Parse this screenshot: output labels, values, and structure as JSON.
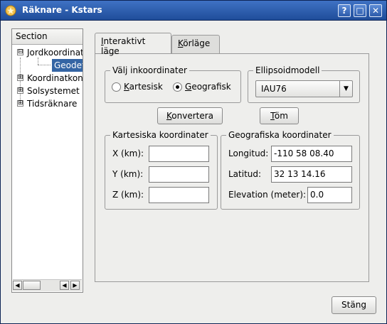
{
  "window": {
    "title": "Räknare - Kstars"
  },
  "titlebar": {
    "help_label": "?",
    "maximize_label": "□",
    "close_label": "✕"
  },
  "sidebar": {
    "header": "Section",
    "items": [
      {
        "label": "Jordkoordinater",
        "expander": "⊟"
      },
      {
        "label": "Geodetisk"
      },
      {
        "label": "Koordinatkonverteringar",
        "expander": "⊞"
      },
      {
        "label": "Solsystemet",
        "expander": "⊞"
      },
      {
        "label": "Tidsräknare",
        "expander": "⊞"
      }
    ]
  },
  "tabs": [
    {
      "label": "Interaktivt läge",
      "mnemonic": "I",
      "rest": "nteraktivt läge"
    },
    {
      "label": "Körläge",
      "mnemonic": "K",
      "rest": "örläge"
    }
  ],
  "input_coords": {
    "title": "Välj inkoordinater",
    "options": [
      {
        "label": "Kartesisk",
        "mnemonic": "K",
        "rest": "artesisk",
        "selected": false
      },
      {
        "label": "Geografisk",
        "mnemonic": "G",
        "rest": "eografisk",
        "selected": true
      }
    ]
  },
  "ellipsoid": {
    "title": "Ellipsoidmodell",
    "selected": "IAU76"
  },
  "actions": {
    "convert": {
      "label": "Konvertera",
      "mnemonic": "K",
      "rest": "onvertera"
    },
    "clear": {
      "label": "Töm",
      "mnemonic": "T",
      "rest": "öm"
    }
  },
  "cartesian": {
    "title": "Kartesiska koordinater",
    "fields": [
      {
        "label": "X (km):",
        "value": ""
      },
      {
        "label": "Y (km):",
        "value": ""
      },
      {
        "label": "Z (km):",
        "value": ""
      }
    ]
  },
  "geographic": {
    "title": "Geografiska koordinater",
    "fields": [
      {
        "label": "Longitud:",
        "value": "-110 58 08.40"
      },
      {
        "label": "Latitud:",
        "value": "32 13 14.16"
      },
      {
        "label": "Elevation (meter):",
        "value": "0.0"
      }
    ]
  },
  "footer": {
    "close_label": "Stäng"
  },
  "colors": {
    "titlebar": "#2c5bab",
    "selection": "#3465a4",
    "window_bg": "#eeeeec"
  }
}
